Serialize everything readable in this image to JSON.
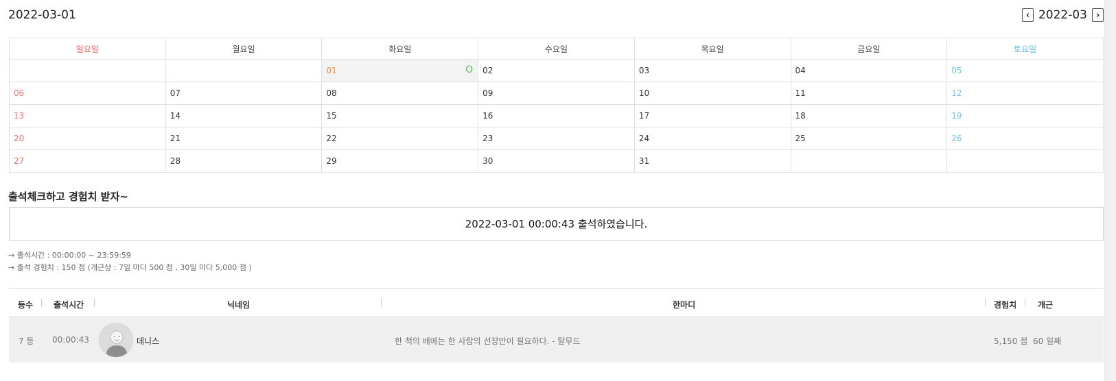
{
  "header": {
    "selected_date": "2022-03-01",
    "current_month": "2022-03",
    "prev_icon": "chevron-left-icon",
    "next_icon": "chevron-right-icon"
  },
  "calendar": {
    "weekdays": [
      "일요일",
      "월요일",
      "화요일",
      "수요일",
      "목요일",
      "금요일",
      "토요일"
    ],
    "weeks": [
      [
        "",
        "",
        "01",
        "02",
        "03",
        "04",
        "05"
      ],
      [
        "06",
        "07",
        "08",
        "09",
        "10",
        "11",
        "12"
      ],
      [
        "13",
        "14",
        "15",
        "16",
        "17",
        "18",
        "19"
      ],
      [
        "20",
        "21",
        "22",
        "23",
        "24",
        "25",
        "26"
      ],
      [
        "27",
        "28",
        "29",
        "30",
        "31",
        "",
        ""
      ]
    ],
    "attended_mark": "O",
    "colors": {
      "sunday": "#f05a5a",
      "saturday": "#5fc0ee",
      "today": "#ef8a3a",
      "check": "#53c05a"
    }
  },
  "attendance": {
    "title": "출석체크하고 경험치 받자~",
    "message": "2022-03-01 00:00:43 출석하였습니다.",
    "info_time": "→ 출석시간 : 00:00:00 ~ 23:59:59",
    "info_exp": "→ 출석 경험치 : 150 점 (개근상 : 7일 마다 500 점 , 30일 마다 5,000 점 )"
  },
  "list": {
    "columns": {
      "rank": "등수",
      "time": "출석시간",
      "nickname": "닉네임",
      "comment": "한마디",
      "exp": "경험치",
      "streak": "개근"
    },
    "rows": [
      {
        "rank": "7 등",
        "time": "00:00:43",
        "avatar_icon": "user-avatar-icon",
        "nickname": "데니스",
        "comment": "한 척의 배에는 한 사람의 선장만이 필요하다. - 탈무드",
        "exp": "5,150 점",
        "streak": "60 일째"
      }
    ]
  }
}
